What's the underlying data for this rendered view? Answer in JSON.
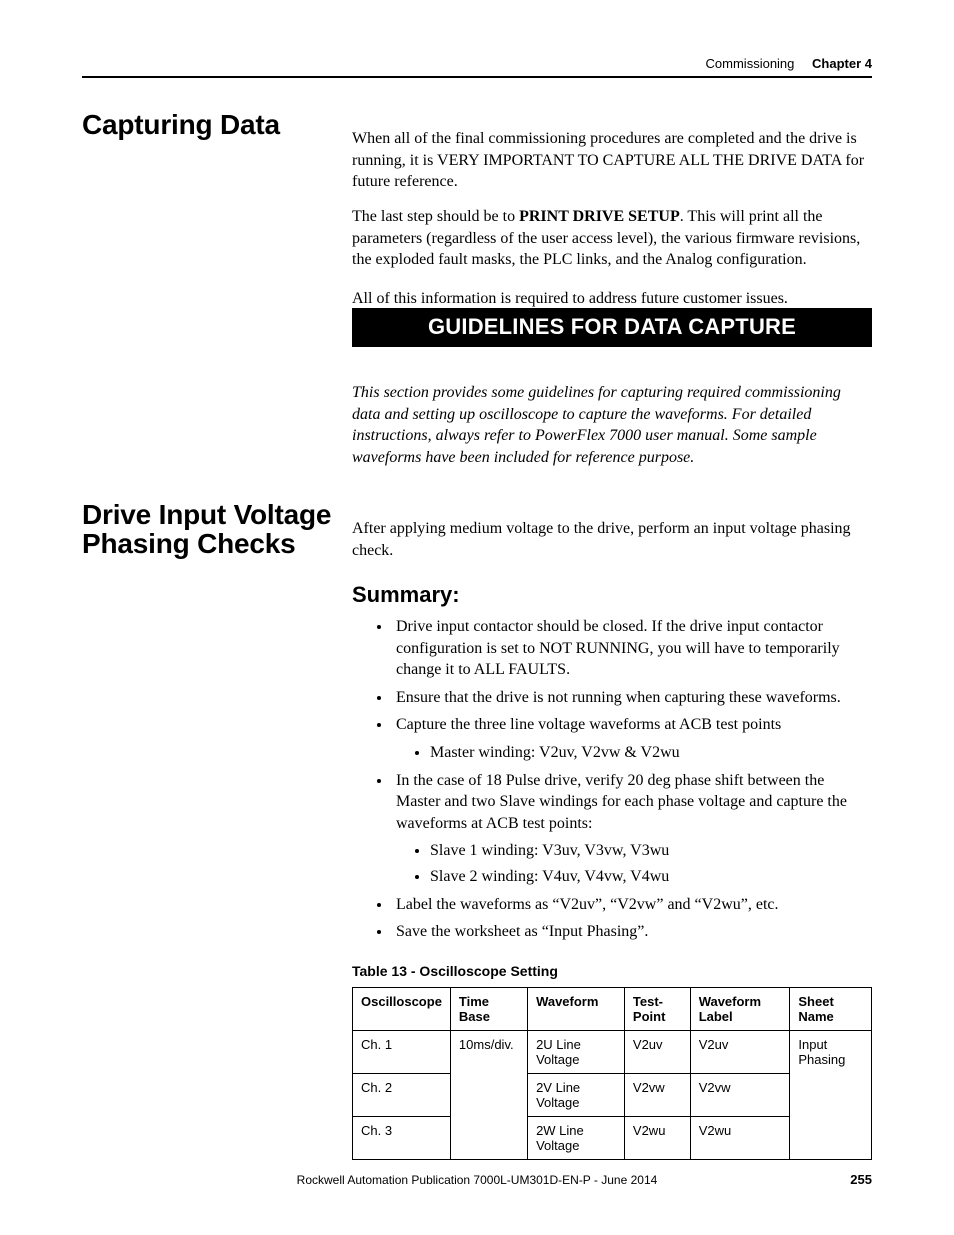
{
  "header": {
    "section": "Commissioning",
    "chapter": "Chapter 4"
  },
  "section1": {
    "title": "Capturing Data",
    "p1a": "When all of the final commissioning procedures are completed and the drive is running, it is VERY IMPORTANT TO CAPTURE ALL THE DRIVE DATA for future reference.",
    "p2a": "The last step should be to ",
    "p2b": "PRINT DRIVE SETUP",
    "p2c": ". This will print all the parameters (regardless of the user access level), the various firmware revisions, the exploded fault masks, the PLC links, and the Analog configuration.",
    "p3": "All of this information is required to address future customer issues.",
    "banner": "GUIDELINES FOR DATA CAPTURE",
    "p4": "This section provides some guidelines for capturing required commissioning data and setting up oscilloscope to capture the waveforms. For detailed instructions, always refer to PowerFlex 7000 user manual. Some sample waveforms have been included for reference purpose."
  },
  "section2": {
    "title": "Drive Input Voltage Phasing Checks",
    "p1": "After applying medium voltage to the drive, perform an input voltage phasing check.",
    "summary_heading": "Summary:",
    "bullets": {
      "b1": "Drive input contactor should be closed. If the drive input contactor configuration is set to NOT RUNNING, you will have to temporarily change it to ALL FAULTS.",
      "b2": "Ensure that the drive is not running when capturing these waveforms.",
      "b3": "Capture the three line voltage waveforms at ACB test points",
      "b3a": "Master winding: V2uv, V2vw & V2wu",
      "b4": "In the case of 18 Pulse drive, verify 20 deg phase shift between the Master and two Slave windings for each phase voltage and capture the waveforms at ACB test points:",
      "b4a": "Slave 1 winding: V3uv, V3vw, V3wu",
      "b4b": "Slave 2 winding: V4uv, V4vw, V4wu",
      "b5": "Label the waveforms as “V2uv”, “V2vw” and “V2wu”, etc.",
      "b6": "Save the worksheet as “Input Phasing”."
    },
    "table": {
      "caption": "Table 13 - Oscilloscope Setting",
      "headers": {
        "c1": "Oscilloscope",
        "c2": "Time Base",
        "c3": "Waveform",
        "c4": "Test-Point",
        "c5": "Waveform Label",
        "c6": "Sheet Name"
      },
      "rows": [
        {
          "osc": "Ch. 1",
          "tb": "10ms/div.",
          "wf": "2U Line Voltage",
          "tp": "V2uv",
          "wl": "V2uv",
          "sn": "Input Phasing"
        },
        {
          "osc": "Ch. 2",
          "tb": "",
          "wf": "2V Line Voltage",
          "tp": "V2vw",
          "wl": "V2vw",
          "sn": ""
        },
        {
          "osc": "Ch. 3",
          "tb": "",
          "wf": "2W Line Voltage",
          "tp": "V2wu",
          "wl": "V2wu",
          "sn": ""
        }
      ]
    }
  },
  "footer": {
    "pub": "Rockwell Automation Publication 7000L-UM301D-EN-P - June 2014",
    "page": "255"
  }
}
